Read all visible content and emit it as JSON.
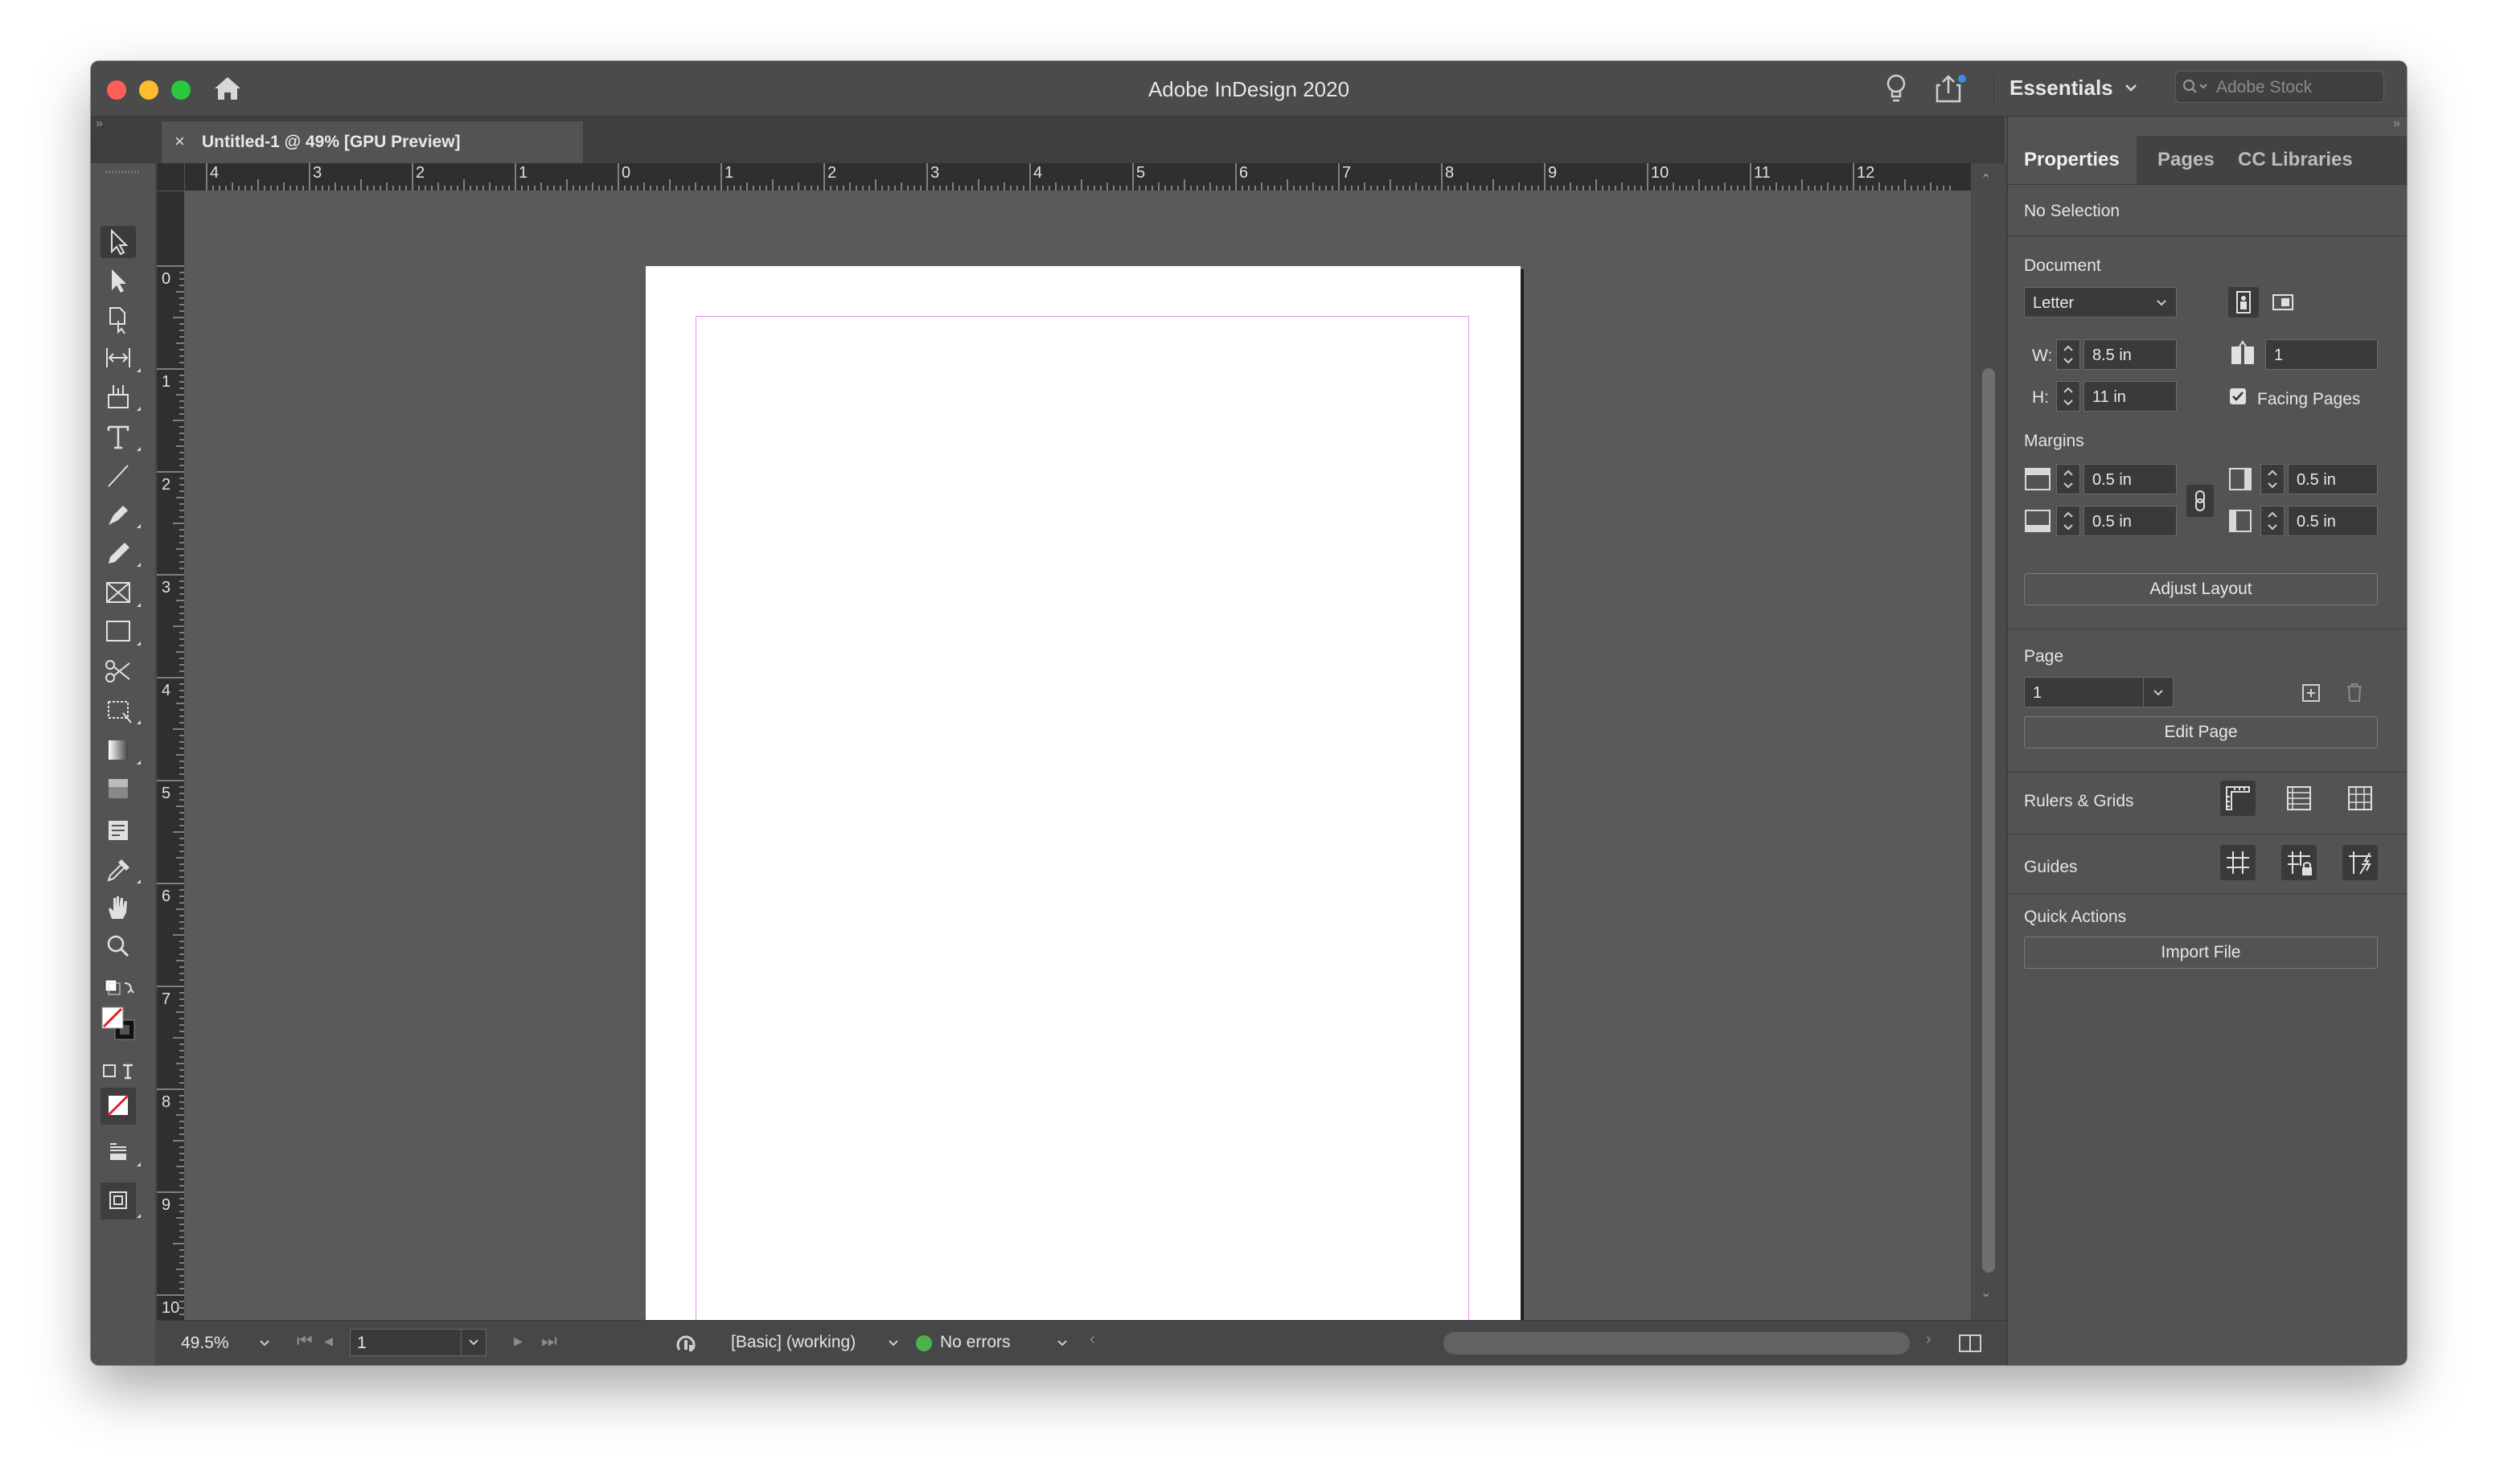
{
  "app": {
    "title": "Adobe InDesign 2020",
    "workspace": "Essentials",
    "stock_placeholder": "Adobe Stock"
  },
  "document_tab": {
    "label": "Untitled-1 @ 49% [GPU Preview]",
    "close_label": "×"
  },
  "ruler": {
    "horizontal": [
      "4",
      "3",
      "2",
      "1",
      "0",
      "1",
      "2",
      "3",
      "4",
      "5",
      "6",
      "7",
      "8",
      "9",
      "10",
      "11",
      "12"
    ],
    "vertical": [
      "0",
      "1",
      "2",
      "3",
      "4",
      "5",
      "6",
      "7",
      "8",
      "9",
      "10",
      "1"
    ]
  },
  "status_bar": {
    "zoom": "49.5%",
    "page": "1",
    "profile": "[Basic] (working)",
    "errors": "No errors",
    "error_status_color": "#4bb34b"
  },
  "panel": {
    "tabs": [
      "Properties",
      "Pages",
      "CC Libraries"
    ],
    "selection_status": "No Selection",
    "document": {
      "heading": "Document",
      "preset": "Letter",
      "width_label": "W:",
      "width": "8.5 in",
      "height_label": "H:",
      "height": "11 in",
      "pages": "1",
      "facing_pages_label": "Facing Pages",
      "facing_pages_checked": true
    },
    "margins": {
      "heading": "Margins",
      "top": "0.5 in",
      "bottom": "0.5 in",
      "inside": "0.5 in",
      "outside": "0.5 in"
    },
    "adjust_layout_label": "Adjust Layout",
    "page": {
      "heading": "Page",
      "value": "1",
      "edit_label": "Edit Page"
    },
    "rulers_grids_heading": "Rulers & Grids",
    "guides_heading": "Guides",
    "quick_actions": {
      "heading": "Quick Actions",
      "import_label": "Import File"
    }
  },
  "colors": {
    "ui_background": "#535353",
    "pasteboard": "#5a5a5a",
    "margin_guide": "#e48ef0",
    "page": "#ffffff"
  }
}
